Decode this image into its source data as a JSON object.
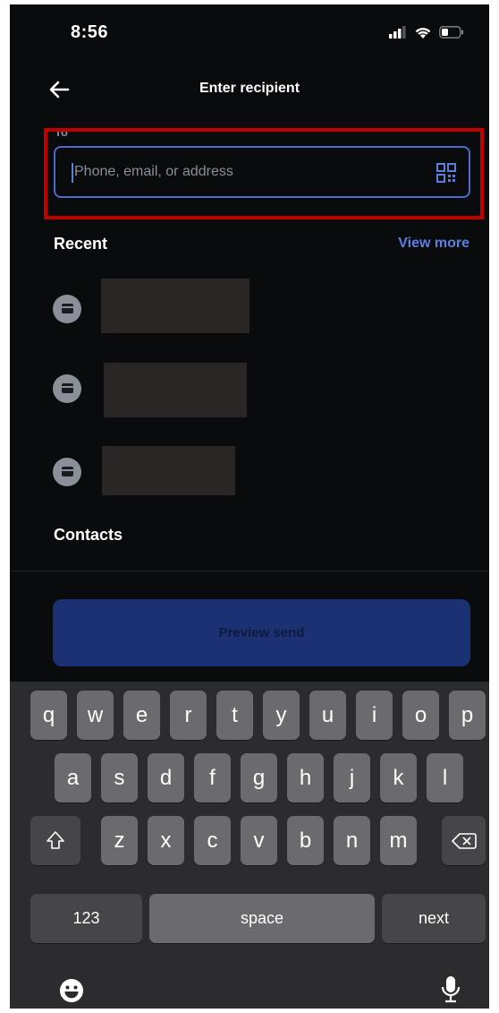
{
  "status_bar": {
    "time": "8:56"
  },
  "header": {
    "title": "Enter recipient"
  },
  "recipient_field": {
    "label": "To",
    "placeholder": "Phone, email, or address"
  },
  "recent": {
    "title": "Recent",
    "view_more": "View more"
  },
  "contacts": {
    "title": "Contacts"
  },
  "preview_button": {
    "label": "Preview send"
  },
  "keyboard": {
    "row1": [
      "q",
      "w",
      "e",
      "r",
      "t",
      "y",
      "u",
      "i",
      "o",
      "p"
    ],
    "row2": [
      "a",
      "s",
      "d",
      "f",
      "g",
      "h",
      "j",
      "k",
      "l"
    ],
    "row3": [
      "z",
      "x",
      "c",
      "v",
      "b",
      "n",
      "m"
    ],
    "numbers": "123",
    "space": "space",
    "next": "next"
  },
  "colors": {
    "accent": "#5b7fe0",
    "highlight": "#c20000",
    "button": "#1c3173"
  }
}
